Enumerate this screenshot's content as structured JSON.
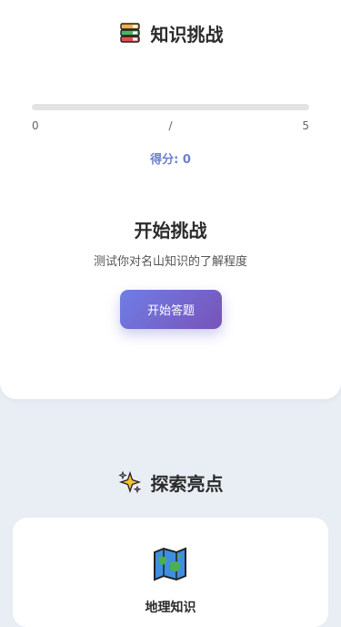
{
  "quiz": {
    "title": "知识挑战",
    "icon": "books-icon",
    "progress": {
      "current_label": "0",
      "separator": "/",
      "total_label": "5",
      "fraction": 0
    },
    "score_text": "得分: 0",
    "start_heading": "开始挑战",
    "start_description": "测试你对名山知识的了解程度",
    "start_button_label": "开始答题",
    "accent_color": "#6f7ee6"
  },
  "explore": {
    "title": "探索亮点",
    "icon": "sparkles-icon",
    "cards": [
      {
        "icon": "world-map-icon",
        "label": "地理知识"
      }
    ]
  }
}
